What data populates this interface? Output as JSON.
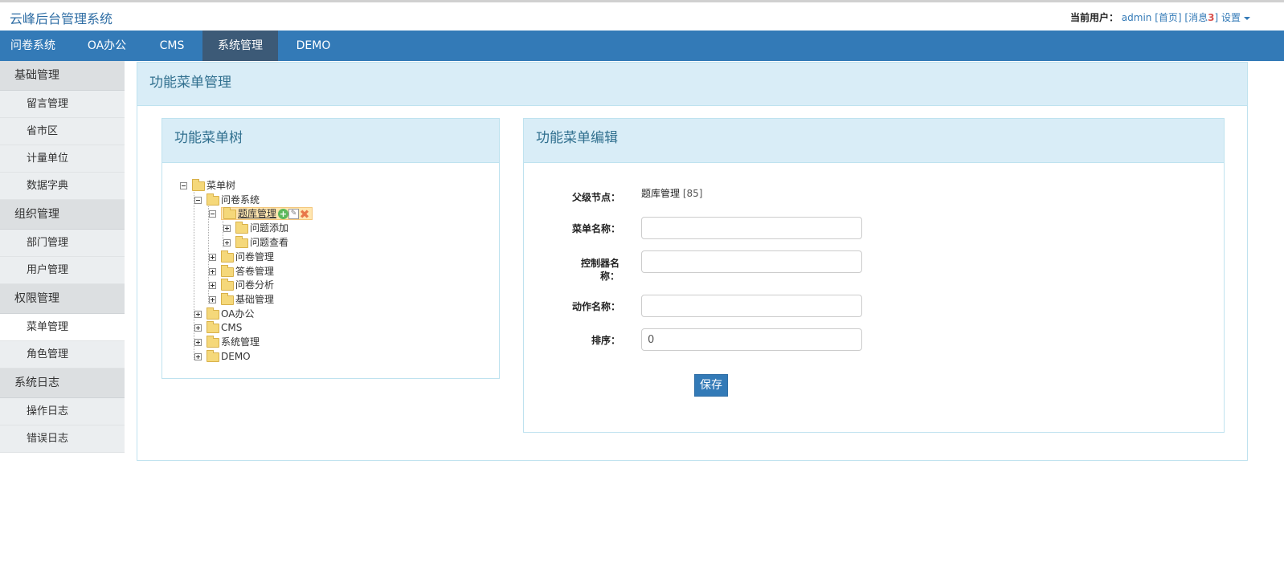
{
  "header": {
    "app_title": "云峰后台管理系统",
    "current_user_label": "当前用户：",
    "username": "admin",
    "home_link": "[首页]",
    "messages_prefix": "[消息",
    "messages_count": "3",
    "messages_suffix": "]",
    "settings_label": "设置"
  },
  "nav": {
    "items": [
      {
        "label": "问卷系统"
      },
      {
        "label": "OA办公"
      },
      {
        "label": "CMS"
      },
      {
        "label": "系统管理"
      },
      {
        "label": "DEMO"
      }
    ],
    "active_index": 3
  },
  "sidebar": {
    "groups": [
      {
        "label": "基础管理",
        "items": [
          "留言管理",
          "省市区",
          "计量单位",
          "数据字典"
        ]
      },
      {
        "label": "组织管理",
        "items": [
          "部门管理",
          "用户管理"
        ]
      },
      {
        "label": "权限管理",
        "items": [
          "菜单管理",
          "角色管理"
        ]
      },
      {
        "label": "系统日志",
        "items": [
          "操作日志",
          "错误日志"
        ]
      }
    ],
    "active_item": "菜单管理"
  },
  "main": {
    "title": "功能菜单管理"
  },
  "tree_panel": {
    "title": "功能菜单树",
    "nodes": {
      "root": "菜单树",
      "wenjuan": "问卷系统",
      "tiku": "题库管理",
      "wenti_add": "问题添加",
      "wenti_view": "问题查看",
      "wenjuan_mgmt": "问卷管理",
      "dajuan_mgmt": "答卷管理",
      "wenjuan_analysis": "问卷分析",
      "jichu_mgmt": "基础管理",
      "oa": "OA办公",
      "cms": "CMS",
      "xitong": "系统管理",
      "demo": "DEMO"
    }
  },
  "edit_panel": {
    "title": "功能菜单编辑",
    "parent_label": "父级节点：",
    "parent_name": "题库管理",
    "parent_id": "[85]",
    "menu_name_label": "菜单名称：",
    "menu_name_value": "",
    "controller_label": "控制器名称：",
    "controller_value": "",
    "action_label": "动作名称：",
    "action_value": "",
    "order_label": "排序：",
    "order_value": "0",
    "save_label": "保存"
  },
  "colors": {
    "primary": "#337ab7",
    "panel_header": "#d9edf7",
    "panel_title": "#31708f",
    "nav_active": "#3c5a77"
  }
}
